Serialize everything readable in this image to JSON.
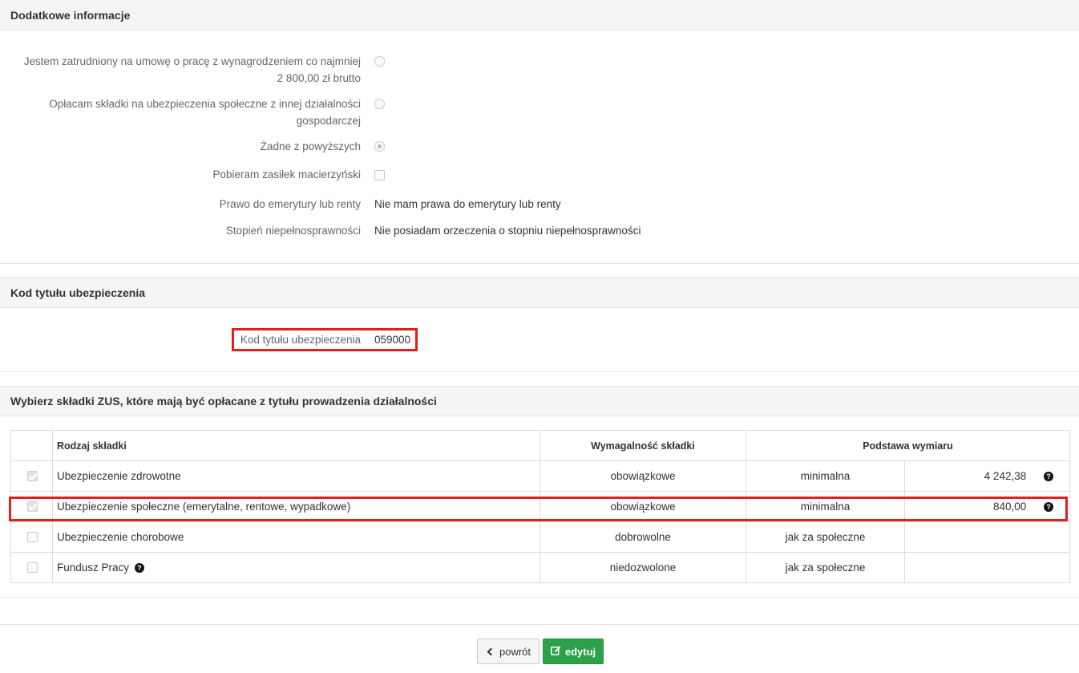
{
  "section_additional": {
    "title": "Dodatkowe informacje",
    "employment_label_1": "Jestem zatrudniony na umowę o pracę z wynagrodzeniem co najmniej",
    "employment_label_2": "2 800,00 zł brutto",
    "other_business_label_1": "Opłacam składki na ubezpieczenia społeczne z innej działalności",
    "other_business_label_2": "gospodarczej",
    "none_label": "Żadne z powyższych",
    "maternity_label": "Pobieram zasiłek macierzyński",
    "pension_label": "Prawo do emerytury lub renty",
    "pension_value": "Nie mam prawa do emerytury lub renty",
    "disability_label": "Stopień niepełnosprawności",
    "disability_value": "Nie posiadam orzeczenia o stopniu niepełnosprawności"
  },
  "section_code": {
    "title": "Kod tytułu ubezpieczenia",
    "code_label": "Kod tytułu ubezpieczenia",
    "code_value": "059000"
  },
  "section_zus": {
    "title": "Wybierz składki ZUS, które mają być opłacane z tytułu prowadzenia działalności",
    "headers": {
      "type": "Rodzaj składki",
      "requirement": "Wymagalność składki",
      "base": "Podstawa wymiaru"
    },
    "rows": [
      {
        "name": "Ubezpieczenie zdrowotne",
        "requirement": "obowiązkowe",
        "base": "minimalna",
        "amount": "4 242,38",
        "checked": true
      },
      {
        "name": "Ubezpieczenie społeczne (emerytalne, rentowe, wypadkowe)",
        "requirement": "obowiązkowe",
        "base": "minimalna",
        "amount": "840,00",
        "checked": true
      },
      {
        "name": "Ubezpieczenie chorobowe",
        "requirement": "dobrowolne",
        "base": "jak za społeczne",
        "amount": "",
        "checked": false
      },
      {
        "name": "Fundusz Pracy",
        "requirement": "niedozwolone",
        "base": "jak za społeczne",
        "amount": "",
        "checked": false
      }
    ]
  },
  "buttons": {
    "back_label": "powrót",
    "edit_label": "edytuj"
  },
  "colors": {
    "highlight": "#e0201c",
    "edit_button": "#2ca148"
  },
  "icons": {
    "back": "chevron-left-icon",
    "edit": "edit-icon",
    "help": "question-circle-icon"
  }
}
